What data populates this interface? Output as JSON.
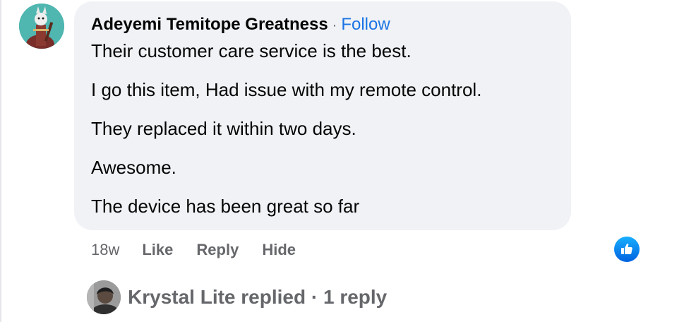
{
  "comment": {
    "author": "Adeyemi Temitope Greatness",
    "separator": "·",
    "follow_label": "Follow",
    "lines": [
      "Their customer care service is the best.",
      "I go this item, Had issue with my remote control.",
      "They replaced it within two days.",
      "Awesome.",
      "The device has been great so far"
    ],
    "timestamp": "18w",
    "actions": {
      "like": "Like",
      "reply": "Reply",
      "hide": "Hide"
    },
    "reaction_icon": "thumbs-up-icon"
  },
  "replies": {
    "summary": "Krystal Lite replied · 1 reply"
  },
  "colors": {
    "bubble_bg": "#f0f2f5",
    "link_blue": "#1b74e4",
    "secondary_text": "#65676b",
    "like_blue": "#1877f2"
  }
}
